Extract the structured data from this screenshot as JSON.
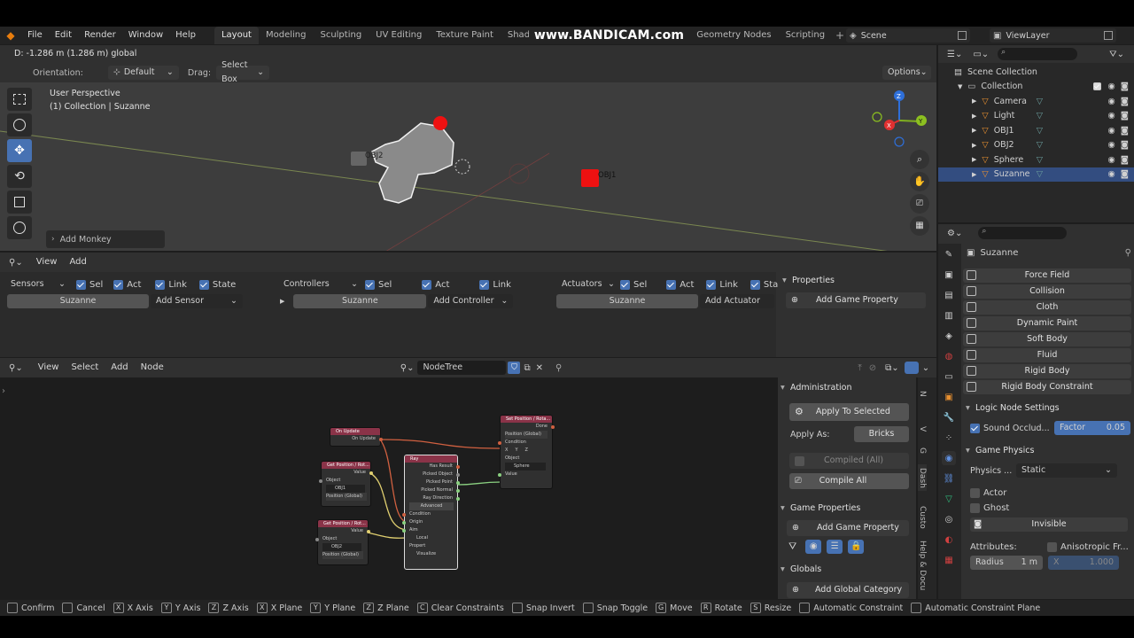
{
  "topbar": {
    "menus": [
      "File",
      "Edit",
      "Render",
      "Window",
      "Help"
    ],
    "workspaces": [
      "Layout",
      "Modeling",
      "Sculpting",
      "UV Editing",
      "Texture Paint",
      "Shadin"
    ],
    "workspaces_right": [
      "Geometry Nodes",
      "Scripting"
    ],
    "watermark": "www.BANDICAM.com",
    "scene": "Scene",
    "view_layer": "ViewLayer"
  },
  "viewport": {
    "header_info": "D: -1.286 m (1.286 m) global",
    "orientation_label": "Orientation:",
    "orientation_value": "Default",
    "drag_label": "Drag:",
    "drag_value": "Select Box",
    "options": "Options",
    "perspective": "User Perspective",
    "collection_info": "(1) Collection | Suzanne",
    "obj2_label": "OBJ2",
    "obj1_label": "OBJ1",
    "last_op": "Add Monkey",
    "gizmo": {
      "x": "X",
      "y": "Y",
      "z": "Z"
    }
  },
  "logic_editor": {
    "menus": [
      "View",
      "Add"
    ],
    "sensors": {
      "label": "Sensors",
      "sel": "Sel",
      "act": "Act",
      "link": "Link",
      "state": "State",
      "object": "Suzanne",
      "add": "Add Sensor"
    },
    "controllers": {
      "label": "Controllers",
      "sel": "Sel",
      "act": "Act",
      "link": "Link",
      "object": "Suzanne",
      "add": "Add Controller"
    },
    "actuators": {
      "label": "Actuators",
      "sel": "Sel",
      "act": "Act",
      "link": "Link",
      "state": "Sta",
      "object": "Suzanne",
      "add": "Add Actuator"
    },
    "properties": {
      "title": "Properties",
      "add": "Add Game Property"
    }
  },
  "node_editor": {
    "menus": [
      "View",
      "Select",
      "Add",
      "Node"
    ],
    "tree_name": "NodeTree",
    "sidebar": {
      "administration": "Administration",
      "apply_selected": "Apply To Selected",
      "apply_as_label": "Apply As:",
      "apply_as_value": "Bricks",
      "compiled_all": "Compiled (All)",
      "compile_all": "Compile All",
      "game_properties": "Game Properties",
      "add_game_property": "Add Game Property",
      "globals": "Globals",
      "add_global_category": "Add Global Category"
    },
    "vertical_tabs": [
      "N",
      "V",
      "G",
      "Dash",
      "Custo",
      "Help & Docu"
    ],
    "nodes": {
      "on_update": {
        "title": "On Update",
        "out": "On Update"
      },
      "get_pos_1": {
        "title": "Get Position / Rot...",
        "value": "Value",
        "object": "Object",
        "obj": "OBJ1",
        "mode": "Position (Global)"
      },
      "get_pos_2": {
        "title": "Get Position / Rot...",
        "value": "Value",
        "object": "Object",
        "obj": "OBJ2",
        "mode": "Position (Global)"
      },
      "ray": {
        "title": "Ray",
        "outputs": [
          "Has Result",
          "Picked Object",
          "Picked Point",
          "Picked Normal",
          "Ray Direction"
        ],
        "advanced": "Advanced",
        "inputs": [
          "Condition",
          "Origin",
          "Aim",
          "Local",
          "Propert",
          "Visualize"
        ]
      },
      "set_pos": {
        "title": "Set Position / Rota...",
        "done": "Done",
        "mode": "Position (Global)",
        "condition": "Condition",
        "x": "X",
        "y": "Y",
        "z": "Z",
        "object": "Object",
        "obj": "Sphere",
        "value": "Value"
      }
    }
  },
  "outliner": {
    "root": "Scene Collection",
    "collection": "Collection",
    "items": [
      {
        "name": "Camera",
        "color": "#6a9c9c"
      },
      {
        "name": "Light",
        "color": "#6a9c9c"
      },
      {
        "name": "OBJ1",
        "color": "#6a9c9c"
      },
      {
        "name": "OBJ2",
        "color": "#6a9c9c"
      },
      {
        "name": "Sphere",
        "color": "#6a9c9c"
      },
      {
        "name": "Suzanne",
        "color": "#6a9c9c"
      }
    ]
  },
  "properties": {
    "object_name": "Suzanne",
    "physics_buttons": [
      "Force Field",
      "Collision",
      "Cloth",
      "Dynamic Paint",
      "Soft Body",
      "Fluid",
      "Rigid Body",
      "Rigid Body Constraint"
    ],
    "logic_node_settings": "Logic Node Settings",
    "sound_occlusion": "Sound Occlud...",
    "factor_label": "Factor",
    "factor_value": "0.05",
    "game_physics": "Game Physics",
    "physics_label": "Physics ...",
    "physics_value": "Static",
    "actor": "Actor",
    "ghost": "Ghost",
    "invisible": "Invisible",
    "attributes": "Attributes:",
    "anisotropic": "Anisotropic Fr...",
    "radius_label": "Radius",
    "radius_value": "1 m",
    "aniso_x": "X",
    "aniso_x_val": "1.000"
  },
  "statusbar": {
    "items": [
      {
        "key": "",
        "label": "Confirm"
      },
      {
        "key": "",
        "label": "Cancel"
      },
      {
        "key": "X",
        "label": "X Axis"
      },
      {
        "key": "Y",
        "label": "Y Axis"
      },
      {
        "key": "Z",
        "label": "Z Axis"
      },
      {
        "key": "X",
        "label": "X Plane"
      },
      {
        "key": "Y",
        "label": "Y Plane"
      },
      {
        "key": "Z",
        "label": "Z Plane"
      },
      {
        "key": "C",
        "label": "Clear Constraints"
      },
      {
        "key": "",
        "label": "Snap Invert"
      },
      {
        "key": "",
        "label": "Snap Toggle"
      },
      {
        "key": "G",
        "label": "Move"
      },
      {
        "key": "R",
        "label": "Rotate"
      },
      {
        "key": "S",
        "label": "Resize"
      },
      {
        "key": "",
        "label": "Automatic Constraint"
      },
      {
        "key": "",
        "label": "Automatic Constraint Plane"
      }
    ]
  }
}
